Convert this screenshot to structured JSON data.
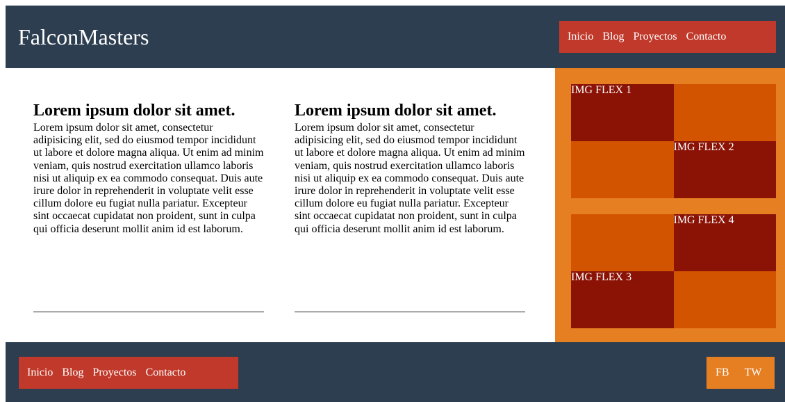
{
  "header": {
    "brand": "FalconMasters",
    "nav": [
      "Inicio",
      "Blog",
      "Proyectos",
      "Contacto"
    ]
  },
  "articles": [
    {
      "title": "Lorem ipsum dolor sit amet.",
      "body": "Lorem ipsum dolor sit amet, consectetur adipisicing elit, sed do eiusmod tempor incididunt ut labore et dolore magna aliqua. Ut enim ad minim veniam, quis nostrud exercitation ullamco laboris nisi ut aliquip ex ea commodo consequat. Duis aute irure dolor in reprehenderit in voluptate velit esse cillum dolore eu fugiat nulla pariatur. Excepteur sint occaecat cupidatat non proident, sunt in culpa qui officia deserunt mollit anim id est laborum."
    },
    {
      "title": "Lorem ipsum dolor sit amet.",
      "body": "Lorem ipsum dolor sit amet, consectetur adipisicing elit, sed do eiusmod tempor incididunt ut labore et dolore magna aliqua. Ut enim ad minim veniam, quis nostrud exercitation ullamco laboris nisi ut aliquip ex ea commodo consequat. Duis aute irure dolor in reprehenderit in voluptate velit esse cillum dolore eu fugiat nulla pariatur. Excepteur sint occaecat cupidatat non proident, sunt in culpa qui officia deserunt mollit anim id est laborum."
    }
  ],
  "sidebar": {
    "flex_labels": [
      "IMG FLEX 1",
      "IMG FLEX 2",
      "IMG FLEX 3",
      "IMG FLEX 4"
    ]
  },
  "footer": {
    "nav": [
      "Inicio",
      "Blog",
      "Proyectos",
      "Contacto"
    ],
    "social": [
      "FB",
      "TW"
    ]
  },
  "colors": {
    "header_bg": "#2c3e50",
    "nav_bg": "#c0392b",
    "sidebar_bg": "#e67e22",
    "flex_dark": "#8b1306",
    "flex_orange": "#d35400"
  }
}
